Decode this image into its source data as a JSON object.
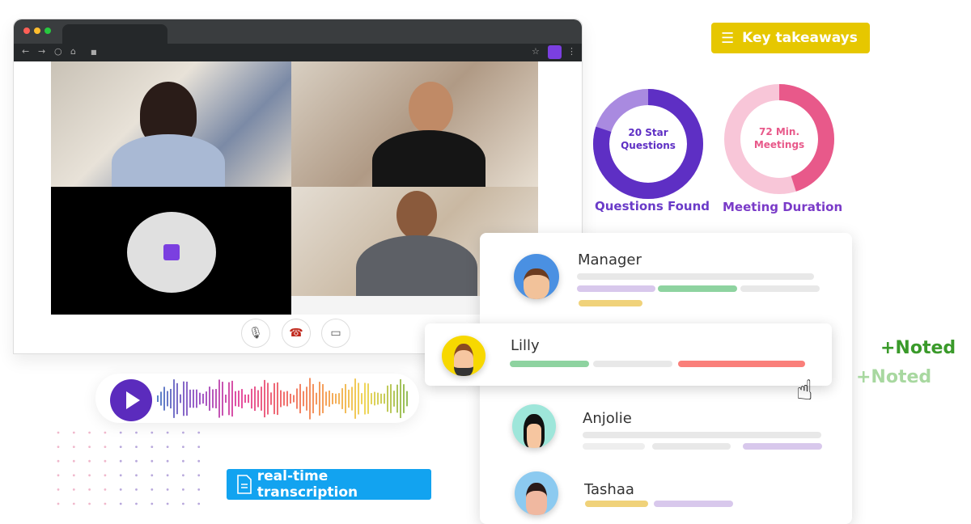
{
  "browser": {
    "nav_icons": [
      "back-arrow-icon",
      "forward-arrow-icon",
      "reload-icon",
      "home-icon",
      "lock-icon",
      "star-icon",
      "extension-icon",
      "more-menu-icon"
    ]
  },
  "call_controls": [
    {
      "name": "mic",
      "icon": "microphone-icon"
    },
    {
      "name": "hangup",
      "icon": "phone-hangup-icon"
    },
    {
      "name": "camera",
      "icon": "video-camera-icon"
    }
  ],
  "key_takeaways": {
    "label": "Key takeaways",
    "icon": "checklist-icon",
    "color": "#e6c700"
  },
  "stats": [
    {
      "line1": "20 Star",
      "line2": "Questions",
      "caption": "Questions Found",
      "fill_fraction": 0.8,
      "color_dark": "#5e2fc4",
      "color_light": "#a98ae0"
    },
    {
      "line1": "72 Min.",
      "line2": "Meetings",
      "caption": "Meeting Duration",
      "fill_fraction": 0.45,
      "color_dark": "#e8598a",
      "color_light": "#f8c6d8"
    }
  ],
  "participants": [
    {
      "name": "Manager"
    },
    {
      "name": "Lilly"
    },
    {
      "name": "Anjolie"
    },
    {
      "name": "Tashaa"
    }
  ],
  "noted": [
    "+Noted",
    "+Noted"
  ],
  "transcription": {
    "label": "real-time transcription",
    "icon": "document-icon",
    "color": "#12a3f0"
  },
  "audio": {
    "icon": "play-icon",
    "accent": "#5b2bbd"
  }
}
